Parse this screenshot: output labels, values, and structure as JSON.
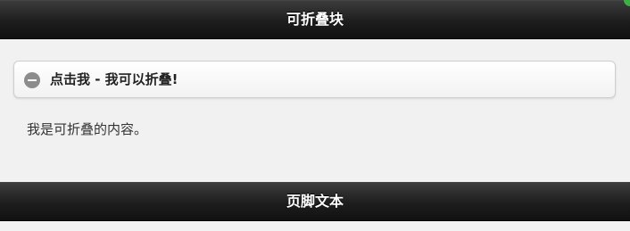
{
  "header": {
    "title": "可折叠块"
  },
  "collapsible": {
    "heading": "点击我 - 我可以折叠!",
    "content": "我是可折叠的内容。",
    "icon": "minus-circle-icon"
  },
  "footer": {
    "text": "页脚文本"
  }
}
